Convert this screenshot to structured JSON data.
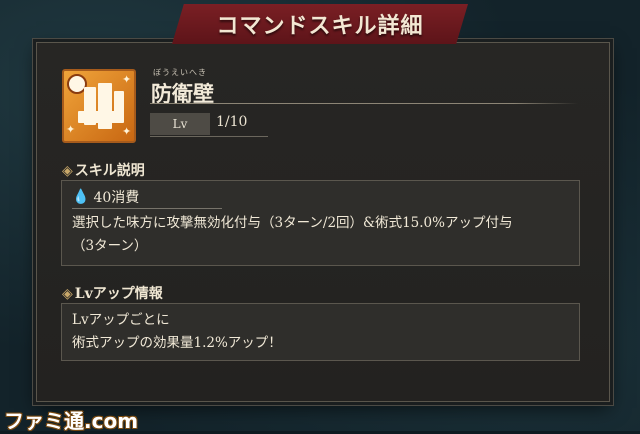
{
  "header": {
    "title": "コマンドスキル詳細"
  },
  "skill": {
    "ruby": "ぼうえいへき",
    "name": "防衛壁",
    "level_label": "Lv",
    "level_value": "1/10"
  },
  "description_section": {
    "heading": "スキル説明",
    "cost_icon": "water-drop-icon",
    "cost_text": "40消費",
    "lines": [
      "選択した味方に攻撃無効化付与（3ターン/2回）&術式15.0%アップ付与",
      "（3ターン）"
    ]
  },
  "levelup_section": {
    "heading": "Lvアップ情報",
    "lines": [
      "Lvアップごとに",
      "術式アップの効果量1.2%アップ！"
    ]
  },
  "watermark": "ファミ通.com"
}
